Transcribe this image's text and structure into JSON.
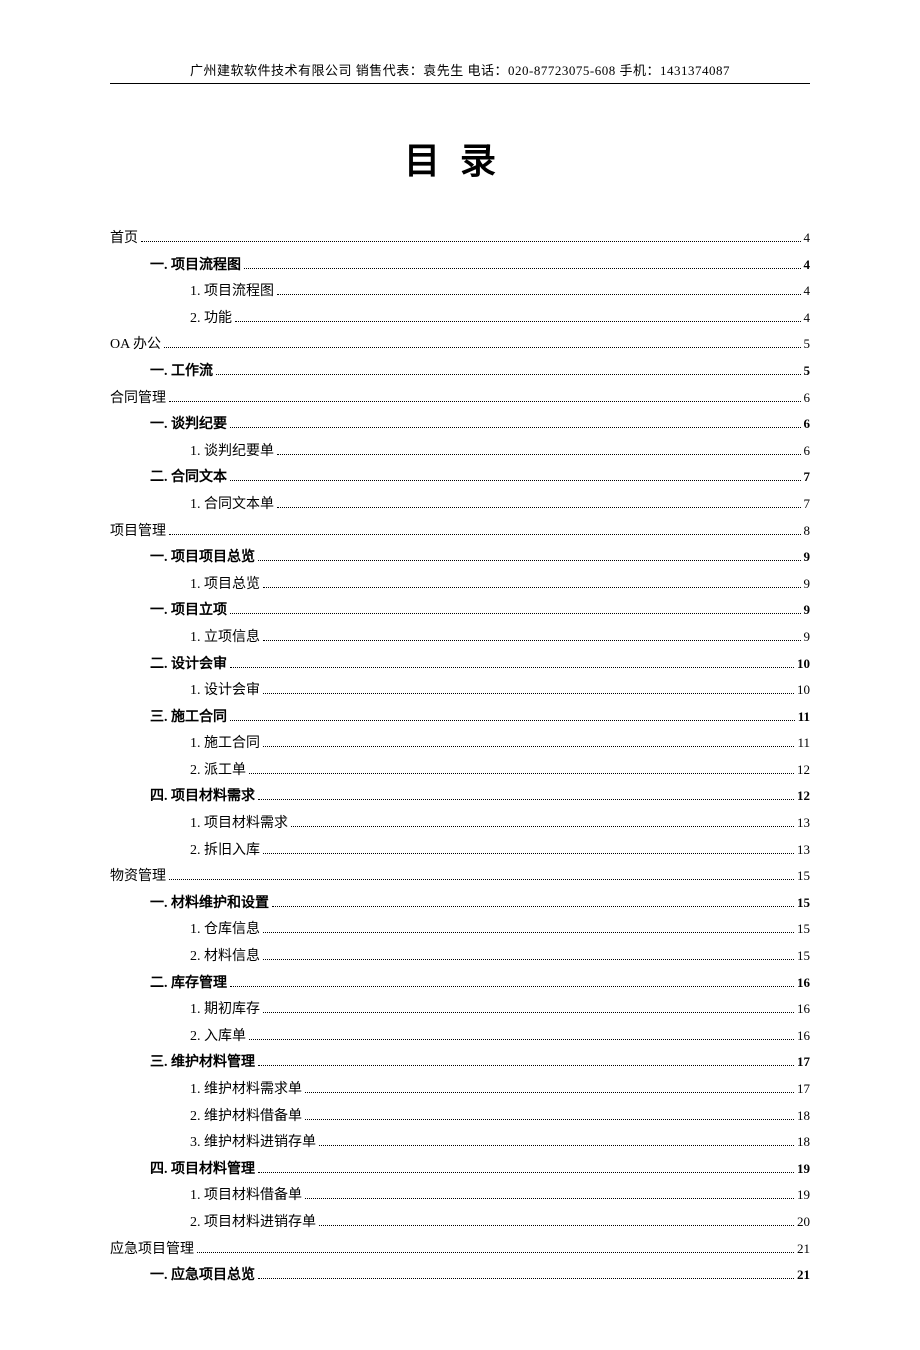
{
  "header": "广州建软软件技术有限公司  销售代表：袁先生  电话：020-87723075-608  手机：1431374087",
  "title": "目录",
  "toc": [
    {
      "level": 0,
      "label": "首页",
      "page": "4"
    },
    {
      "level": 1,
      "label": "一. 项目流程图",
      "page": "4"
    },
    {
      "level": 2,
      "label": "1. 项目流程图",
      "page": "4"
    },
    {
      "level": 2,
      "label": "2. 功能",
      "page": "4"
    },
    {
      "level": 0,
      "label": "OA 办公",
      "page": "5"
    },
    {
      "level": 1,
      "label": "一. 工作流",
      "page": "5"
    },
    {
      "level": 0,
      "label": "合同管理",
      "page": "6"
    },
    {
      "level": 1,
      "label": "一. 谈判纪要",
      "page": "6"
    },
    {
      "level": 2,
      "label": "1. 谈判纪要单",
      "page": "6"
    },
    {
      "level": 1,
      "label": "二.  合同文本",
      "page": "7"
    },
    {
      "level": 2,
      "label": "1.  合同文本单",
      "page": "7"
    },
    {
      "level": 0,
      "label": "项目管理",
      "page": "8"
    },
    {
      "level": 1,
      "label": "一. 项目项目总览",
      "page": "9"
    },
    {
      "level": 2,
      "label": "1. 项目总览",
      "page": "9"
    },
    {
      "level": 1,
      "label": "一. 项目立项",
      "page": "9"
    },
    {
      "level": 2,
      "label": "1. 立项信息",
      "page": "9"
    },
    {
      "level": 1,
      "label": "二. 设计会审",
      "page": "10"
    },
    {
      "level": 2,
      "label": "1. 设计会审",
      "page": "10"
    },
    {
      "level": 1,
      "label": "三. 施工合同",
      "page": "11"
    },
    {
      "level": 2,
      "label": "1. 施工合同",
      "page": "11"
    },
    {
      "level": 2,
      "label": "2. 派工单",
      "page": "12"
    },
    {
      "level": 1,
      "label": "四. 项目材料需求",
      "page": "12"
    },
    {
      "level": 2,
      "label": "1. 项目材料需求",
      "page": "13"
    },
    {
      "level": 2,
      "label": "2. 拆旧入库",
      "page": "13"
    },
    {
      "level": 0,
      "label": "物资管理",
      "page": "15"
    },
    {
      "level": 1,
      "label": "一. 材料维护和设置",
      "page": "15"
    },
    {
      "level": 2,
      "label": "1. 仓库信息",
      "page": "15"
    },
    {
      "level": 2,
      "label": "2. 材料信息",
      "page": "15"
    },
    {
      "level": 1,
      "label": "二. 库存管理",
      "page": "16"
    },
    {
      "level": 2,
      "label": "1. 期初库存",
      "page": "16"
    },
    {
      "level": 2,
      "label": "2. 入库单",
      "page": "16"
    },
    {
      "level": 1,
      "label": "三. 维护材料管理",
      "page": "17"
    },
    {
      "level": 2,
      "label": "1. 维护材料需求单",
      "page": "17"
    },
    {
      "level": 2,
      "label": "2. 维护材料借备单",
      "page": "18"
    },
    {
      "level": 2,
      "label": "3. 维护材料进销存单",
      "page": "18"
    },
    {
      "level": 1,
      "label": "四. 项目材料管理",
      "page": "19"
    },
    {
      "level": 2,
      "label": "1. 项目材料借备单",
      "page": "19"
    },
    {
      "level": 2,
      "label": "2. 项目材料进销存单",
      "page": "20"
    },
    {
      "level": 0,
      "label": "应急项目管理",
      "page": "21"
    },
    {
      "level": 1,
      "label": "一. 应急项目总览",
      "page": "21"
    }
  ]
}
